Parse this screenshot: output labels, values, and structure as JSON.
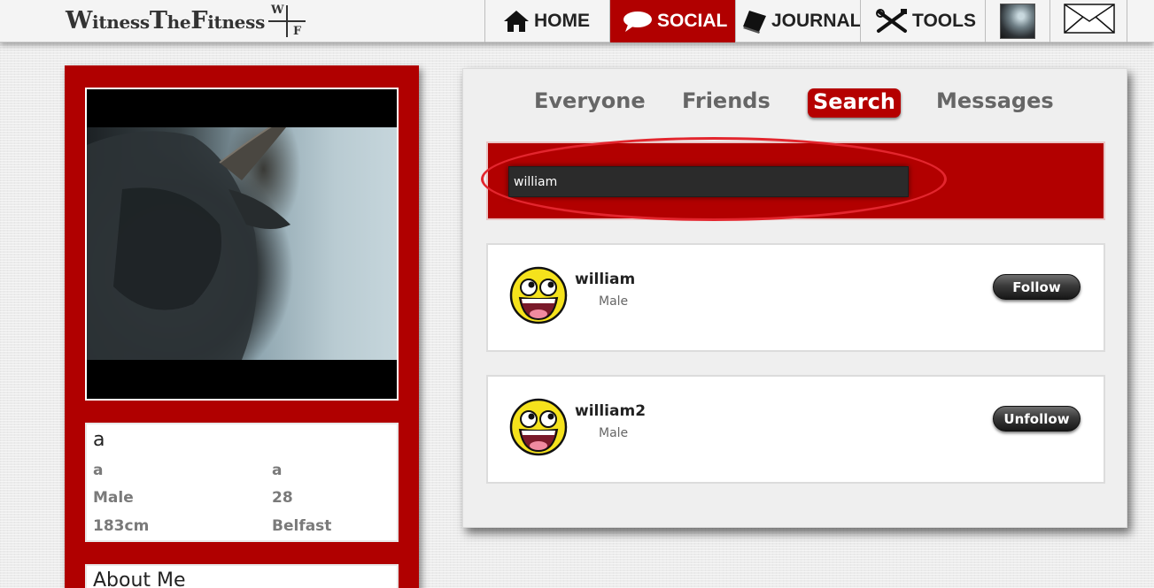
{
  "brand": {
    "w": "W",
    "itness": "itness",
    "t": "T",
    "he": "he",
    "f": "F",
    "itness2": "itness"
  },
  "logo": {
    "top": "W",
    "bottom": "F"
  },
  "nav": {
    "home": "HOME",
    "social": "SOCIAL",
    "journal": "JOURNAL",
    "tools": "TOOLS",
    "avatar_icon": "user-avatar-thumbnail",
    "mail_icon": "envelope-icon"
  },
  "profile": {
    "name": "a",
    "first": "a",
    "last": "a",
    "gender": "Male",
    "age": "28",
    "height": "183cm",
    "location": "Belfast",
    "about_title": "About Me"
  },
  "tabs": {
    "everyone": "Everyone",
    "friends": "Friends",
    "search": "Search",
    "messages": "Messages"
  },
  "search": {
    "value": "william",
    "placeholder": ""
  },
  "results": [
    {
      "name": "william",
      "gender": "Male",
      "button": "Follow"
    },
    {
      "name": "william2",
      "gender": "Male",
      "button": "Unfollow"
    }
  ],
  "colors": {
    "accent": "#b10000",
    "highlight": "#e3262e"
  }
}
